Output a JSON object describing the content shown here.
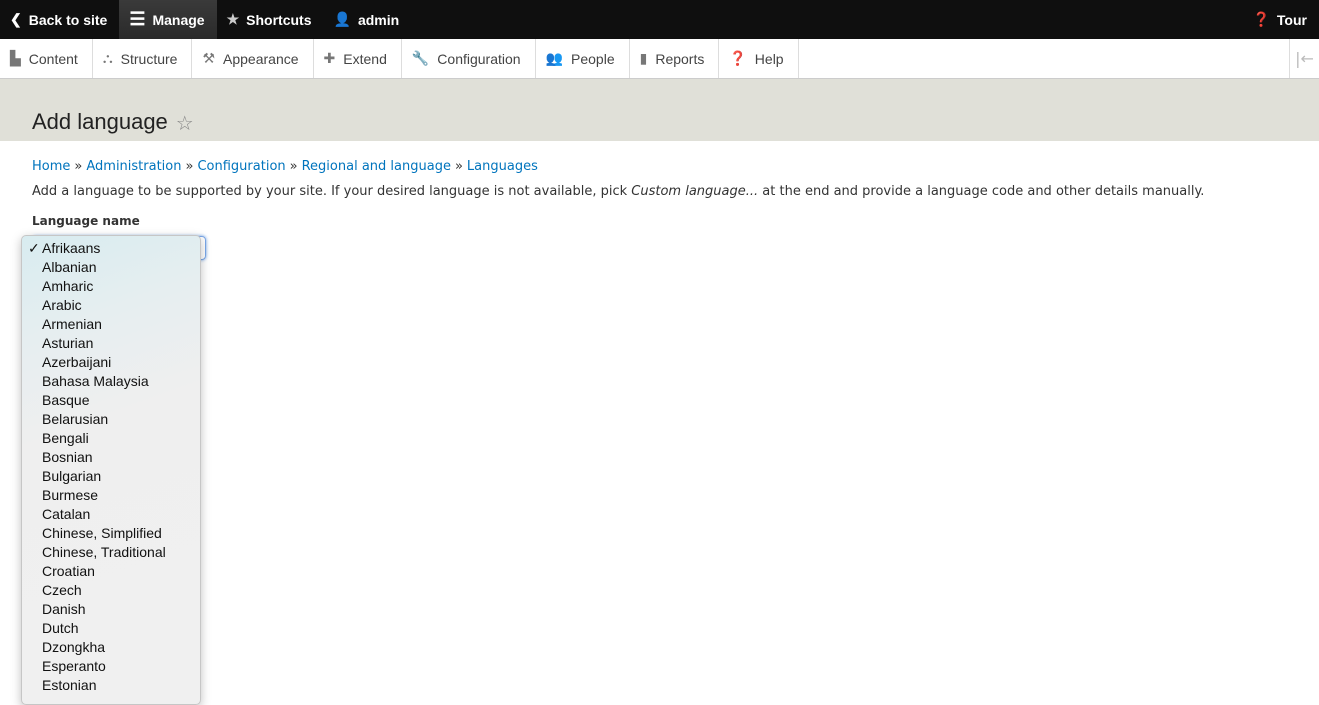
{
  "toolbar": {
    "back": "Back to site",
    "manage": "Manage",
    "shortcuts": "Shortcuts",
    "user": "admin",
    "tour": "Tour"
  },
  "tray": [
    "Content",
    "Structure",
    "Appearance",
    "Extend",
    "Configuration",
    "People",
    "Reports",
    "Help"
  ],
  "page": {
    "title": "Add language"
  },
  "breadcrumb": [
    "Home",
    "Administration",
    "Configuration",
    "Regional and language",
    "Languages"
  ],
  "description": {
    "before": "Add a language to be supported by your site. If your desired language is not available, pick ",
    "em": "Custom language...",
    "after": " at the end and provide a language code and other details manually."
  },
  "form": {
    "label": "Language name",
    "selected": "Afrikaans",
    "check": "✓"
  },
  "options": [
    "Afrikaans",
    "Albanian",
    "Amharic",
    "Arabic",
    "Armenian",
    "Asturian",
    "Azerbaijani",
    "Bahasa Malaysia",
    "Basque",
    "Belarusian",
    "Bengali",
    "Bosnian",
    "Bulgarian",
    "Burmese",
    "Catalan",
    "Chinese, Simplified",
    "Chinese, Traditional",
    "Croatian",
    "Czech",
    "Danish",
    "Dutch",
    "Dzongkha",
    "Esperanto",
    "Estonian"
  ]
}
